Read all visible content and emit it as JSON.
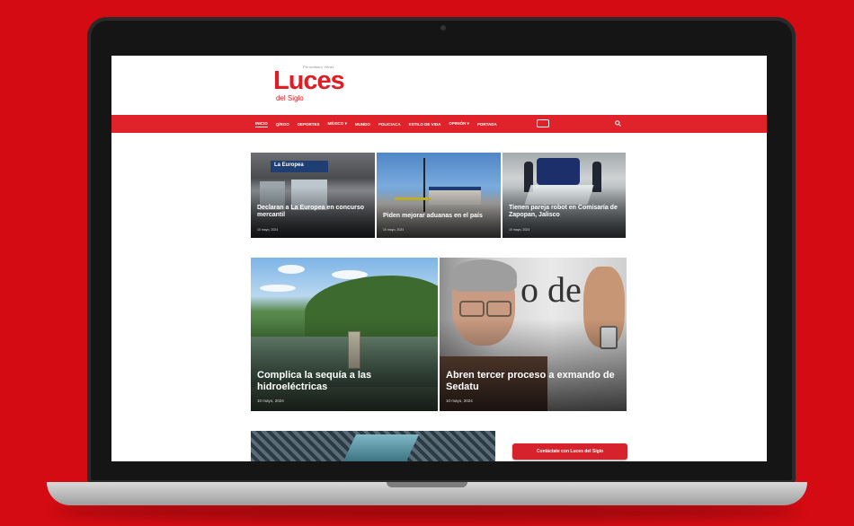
{
  "site": {
    "logo_tag": "Periodismo Veraz",
    "logo_main": "Luces",
    "logo_sub": "del Siglo"
  },
  "nav": {
    "items": [
      "Inicio",
      "Q/Roo",
      "Deportes",
      "México",
      "Mundo",
      "Policiaca",
      "Estilo de Vida",
      "Opinión",
      "Portada"
    ]
  },
  "articles": {
    "row1": [
      {
        "title": "Declaran a La Europea en concurso mercantil",
        "date": "10 mayo, 2024",
        "store_sign": "La Europea"
      },
      {
        "title": "Piden mejorar aduanas en el país",
        "date": "10 mayo, 2024"
      },
      {
        "title": "Tienen pareja robot en Comisaría de Zapopan, Jalisco",
        "date": "10 mayo, 2024"
      }
    ],
    "row2": [
      {
        "title": "Complica la sequía a las hidroeléctricas",
        "date": "10 mayo, 2024"
      },
      {
        "title": "Abren tercer proceso a exmando de Sedatu",
        "date": "10 mayo, 2024",
        "background_text": "o de"
      }
    ]
  },
  "cta": {
    "label": "Contáctate con Luces del Siglo"
  },
  "colors": {
    "brand_red": "#e0232a",
    "background_red": "#d40b12"
  }
}
